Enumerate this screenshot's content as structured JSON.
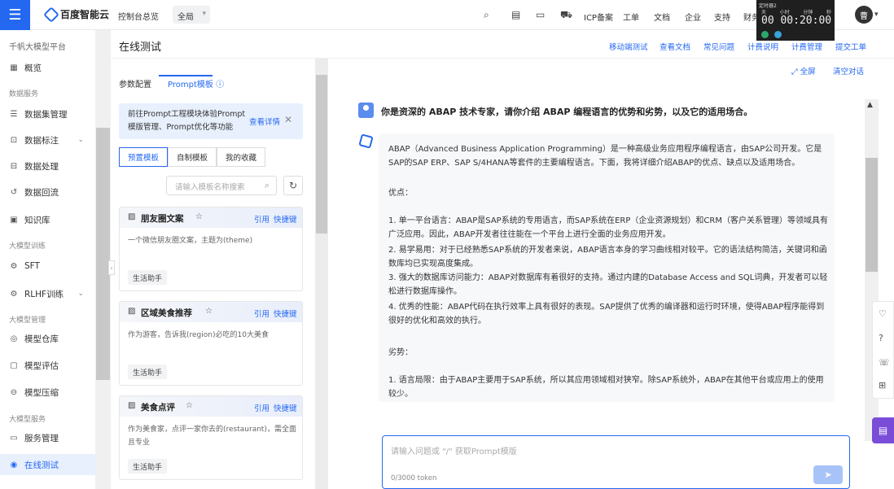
{
  "topbar": {
    "logo_text": "百度智能云",
    "console_link": "控制台总览",
    "region": "全局",
    "nav": [
      "ICP备案",
      "工单",
      "文档",
      "企业",
      "支持",
      "财务"
    ],
    "avatar_text": "曹"
  },
  "timer": {
    "title": "定时器2",
    "units": [
      "天",
      "小时",
      "分钟",
      "秒"
    ],
    "value": "00 00:20:00"
  },
  "sidebar": {
    "platform": "千帆大模型平台",
    "items": [
      {
        "type": "item",
        "label": "概览",
        "icon": "grid-icon"
      },
      {
        "type": "section",
        "label": "数据服务"
      },
      {
        "type": "item",
        "label": "数据集管理",
        "icon": "database-icon"
      },
      {
        "type": "item",
        "label": "数据标注",
        "icon": "annotate-icon",
        "chevron": true
      },
      {
        "type": "item",
        "label": "数据处理",
        "icon": "process-icon"
      },
      {
        "type": "item",
        "label": "数据回流",
        "icon": "reflow-icon"
      },
      {
        "type": "item",
        "label": "知识库",
        "icon": "knowledge-icon"
      },
      {
        "type": "section",
        "label": "大模型训练"
      },
      {
        "type": "item",
        "label": "SFT",
        "icon": "sft-icon"
      },
      {
        "type": "item",
        "label": "RLHF训练",
        "icon": "rlhf-icon",
        "chevron": true
      },
      {
        "type": "section",
        "label": "大模型管理"
      },
      {
        "type": "item",
        "label": "模型仓库",
        "icon": "repository-icon"
      },
      {
        "type": "item",
        "label": "模型评估",
        "icon": "evaluate-icon"
      },
      {
        "type": "item",
        "label": "模型压缩",
        "icon": "compress-icon"
      },
      {
        "type": "section",
        "label": "大模型服务"
      },
      {
        "type": "item",
        "label": "服务管理",
        "icon": "service-icon"
      },
      {
        "type": "item",
        "label": "在线测试",
        "icon": "online-test-icon",
        "active": true
      }
    ]
  },
  "header": {
    "title": "在线测试",
    "links": [
      "移动端测试",
      "查看文档",
      "常见问题",
      "计费说明",
      "计费管理",
      "提交工单"
    ]
  },
  "left_panel": {
    "tabs": [
      "参数配置",
      "Prompt模板"
    ],
    "notice": {
      "text": "前往Prompt工程模块体验Prompt模版管理、Prompt优化等功能",
      "link": "查看详情"
    },
    "segments": [
      "预置模板",
      "自制模板",
      "我的收藏"
    ],
    "search_placeholder": "请输入模板名称搜索",
    "cards": [
      {
        "title": "朋友圈文案",
        "desc": "一个微信朋友圈文案，主题为(theme)",
        "tag": "生活助手",
        "use": "引用",
        "quick": "快捷键"
      },
      {
        "title": "区域美食推荐",
        "desc": "作为游客，告诉我(region)必吃的10大美食",
        "tag": "生活助手",
        "use": "引用",
        "quick": "快捷键"
      },
      {
        "title": "美食点评",
        "desc": "作为美食家，点评一家你去的(restaurant)，需全面且专业",
        "tag": "生活助手",
        "use": "引用",
        "quick": "快捷键"
      }
    ]
  },
  "chat": {
    "fullscreen": "全屏",
    "clear": "清空对话",
    "question": "你是资深的 ABAP 技术专家，请你介绍 ABAP 编程语言的优势和劣势，以及它的适用场合。",
    "answer": [
      "ABAP（Advanced Business Application Programming）是一种高级业务应用程序编程语言，由SAP公司开发。它是SAP的SAP ERP、SAP S/4HANA等套件的主要编程语言。下面，我将详细介绍ABAP的优点、缺点以及适用场合。",
      "优点：",
      "1. 单一平台语言：ABAP是SAP系统的专用语言，而SAP系统在ERP（企业资源规划）和CRM（客户关系管理）等领域具有广泛应用。因此，ABAP开发者往往能在一个平台上进行全面的业务应用开发。",
      "2. 易学易用：对于已经熟悉SAP系统的开发者来说，ABAP语言本身的学习曲线相对较平。它的语法结构简洁，关键词和函数库均已实现高度集成。",
      "3. 强大的数据库访问能力：ABAP对数据库有着很好的支持。通过内建的Database Access and SQL词典，开发者可以轻松进行数据库操作。",
      "4. 优秀的性能：ABAP代码在执行效率上具有很好的表现。SAP提供了优秀的编译器和运行时环境，使得ABAP程序能得到很好的优化和高效的执行。",
      "劣势：",
      "1. 语言局限：由于ABAP主要用于SAP系统，所以其应用领域相对狭窄。除SAP系统外，ABAP在其他平台或应用上的使用较少。"
    ],
    "input_placeholder": "请输入问题或 \"/\" 获取Prompt模版",
    "token_count": "0/3000 token"
  },
  "colors": {
    "accent": "#2468f2",
    "chat_float": "#7a4dd8"
  }
}
